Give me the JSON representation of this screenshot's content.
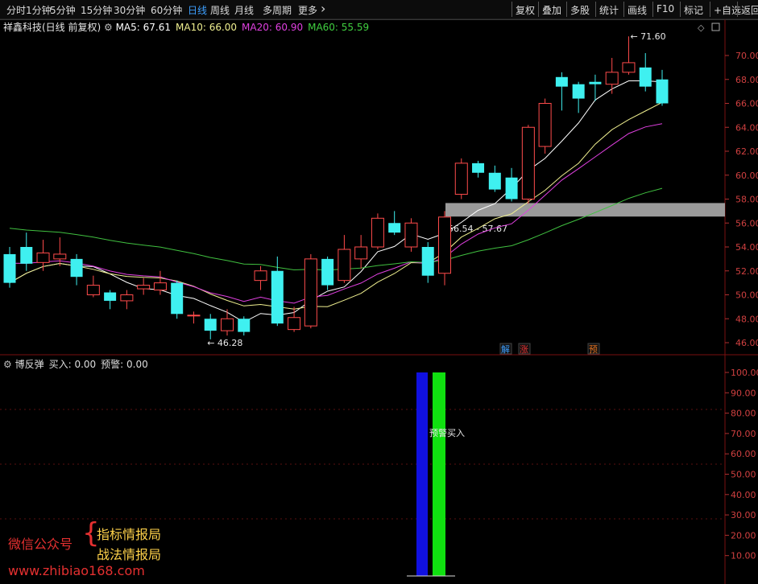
{
  "toolbar": {
    "periods": [
      "分时",
      "1分钟",
      "5分钟",
      "15分钟",
      "30分钟",
      "60分钟",
      "日线",
      "周线",
      "月线",
      "多周期",
      "更多"
    ],
    "active_period": "日线",
    "more_arrow": "›",
    "right_buttons": [
      "复权",
      "叠加",
      "多股",
      "统计",
      "画线",
      "F10",
      "标记",
      "+自选",
      "返回"
    ],
    "colors": {
      "active": "#3ea0ff",
      "normal": "#dcdcdc"
    }
  },
  "main_panel": {
    "stock_title": "祥鑫科技(日线 前复权)",
    "ma_labels": [
      {
        "name": "MA5",
        "value": "67.61",
        "color": "#ffffff"
      },
      {
        "name": "MA10",
        "value": "66.00",
        "color": "#f0f090"
      },
      {
        "name": "MA20",
        "value": "60.90",
        "color": "#e040e0"
      },
      {
        "name": "MA60",
        "value": "55.59",
        "color": "#40d040"
      }
    ],
    "corner_icons": [
      "diamond-icon",
      "window-icon"
    ],
    "high_label": "71.60",
    "low_label": "46.28",
    "range_label": "56.54 - 57.67",
    "markers": [
      {
        "text": "解",
        "color": "#40a0ff"
      },
      {
        "text": "涨",
        "color": "#e03030"
      },
      {
        "text": "预",
        "color": "#e07020"
      }
    ]
  },
  "sub_panel": {
    "indicator_title": "博反弹",
    "buy_label": "买入: 0.00",
    "warn_label": "预警: 0.00",
    "overlay_text": "预警买入",
    "axis_labels": [
      "100.00",
      "90.00",
      "80.00",
      "70.00",
      "60.00",
      "50.00",
      "40.00",
      "30.00",
      "20.00",
      "10.00"
    ]
  },
  "watermark": {
    "line1": "微信公众号",
    "line2": "指标情报局",
    "line3": "战法情报局",
    "url": "www.zhibiao168.com"
  },
  "chart_data": {
    "type": "candlestick",
    "y_axis_ticks": [
      70,
      68,
      66,
      64,
      62,
      60,
      58,
      56,
      54,
      52,
      50,
      48,
      46
    ],
    "candles": [
      {
        "o": 53.4,
        "c": 51.0,
        "h": 54.0,
        "l": 50.6
      },
      {
        "o": 54.0,
        "c": 52.6,
        "h": 55.2,
        "l": 52.0
      },
      {
        "o": 52.7,
        "c": 53.5,
        "h": 54.6,
        "l": 52.0
      },
      {
        "o": 53.0,
        "c": 53.4,
        "h": 54.8,
        "l": 52.4
      },
      {
        "o": 53.0,
        "c": 51.5,
        "h": 53.4,
        "l": 50.8
      },
      {
        "o": 50.0,
        "c": 50.8,
        "h": 51.6,
        "l": 49.8
      },
      {
        "o": 50.2,
        "c": 49.5,
        "h": 50.4,
        "l": 48.8
      },
      {
        "o": 49.5,
        "c": 50.0,
        "h": 50.4,
        "l": 48.8
      },
      {
        "o": 50.5,
        "c": 50.8,
        "h": 51.4,
        "l": 50.0
      },
      {
        "o": 50.4,
        "c": 51.0,
        "h": 52.0,
        "l": 50.0
      },
      {
        "o": 51.0,
        "c": 48.4,
        "h": 51.2,
        "l": 48.0
      },
      {
        "o": 48.3,
        "c": 48.3,
        "h": 48.6,
        "l": 47.6
      },
      {
        "o": 48.0,
        "c": 47.0,
        "h": 48.4,
        "l": 46.28
      },
      {
        "o": 47.0,
        "c": 48.0,
        "h": 48.8,
        "l": 46.6
      },
      {
        "o": 48.0,
        "c": 46.9,
        "h": 48.2,
        "l": 46.6
      },
      {
        "o": 51.2,
        "c": 52.0,
        "h": 52.4,
        "l": 50.4
      },
      {
        "o": 52.0,
        "c": 47.6,
        "h": 53.2,
        "l": 47.4
      },
      {
        "o": 47.1,
        "c": 48.1,
        "h": 49.0,
        "l": 46.9
      },
      {
        "o": 47.4,
        "c": 53.0,
        "h": 53.4,
        "l": 47.2
      },
      {
        "o": 53.0,
        "c": 50.8,
        "h": 53.2,
        "l": 50.4
      },
      {
        "o": 51.2,
        "c": 53.8,
        "h": 55.0,
        "l": 51.0
      },
      {
        "o": 53.0,
        "c": 54.0,
        "h": 55.0,
        "l": 52.2
      },
      {
        "o": 54.0,
        "c": 56.4,
        "h": 56.8,
        "l": 53.8
      },
      {
        "o": 56.0,
        "c": 55.2,
        "h": 57.0,
        "l": 55.0
      },
      {
        "o": 54.0,
        "c": 56.0,
        "h": 56.4,
        "l": 53.6
      },
      {
        "o": 54.0,
        "c": 51.6,
        "h": 54.4,
        "l": 51.0
      },
      {
        "o": 51.8,
        "c": 56.5,
        "h": 57.0,
        "l": 50.8
      },
      {
        "o": 58.4,
        "c": 61.0,
        "h": 61.4,
        "l": 58.0
      },
      {
        "o": 61.0,
        "c": 60.2,
        "h": 61.2,
        "l": 59.8
      },
      {
        "o": 60.2,
        "c": 58.8,
        "h": 60.8,
        "l": 58.6
      },
      {
        "o": 59.8,
        "c": 58.0,
        "h": 60.6,
        "l": 57.8
      },
      {
        "o": 58.0,
        "c": 64.0,
        "h": 64.2,
        "l": 57.6
      },
      {
        "o": 62.4,
        "c": 66.0,
        "h": 66.4,
        "l": 61.8
      },
      {
        "o": 68.2,
        "c": 67.4,
        "h": 68.6,
        "l": 65.4
      },
      {
        "o": 67.6,
        "c": 66.4,
        "h": 67.8,
        "l": 65.2
      },
      {
        "o": 67.8,
        "c": 67.6,
        "h": 68.4,
        "l": 66.2
      },
      {
        "o": 67.6,
        "c": 68.6,
        "h": 69.8,
        "l": 66.8
      },
      {
        "o": 68.6,
        "c": 69.4,
        "h": 71.6,
        "l": 68.4
      },
      {
        "o": 69.0,
        "c": 67.4,
        "h": 70.2,
        "l": 67.0
      },
      {
        "o": 68.0,
        "c": 66.0,
        "h": 68.8,
        "l": 65.8
      }
    ],
    "range_zone": {
      "low": 56.54,
      "high": 57.67
    }
  }
}
